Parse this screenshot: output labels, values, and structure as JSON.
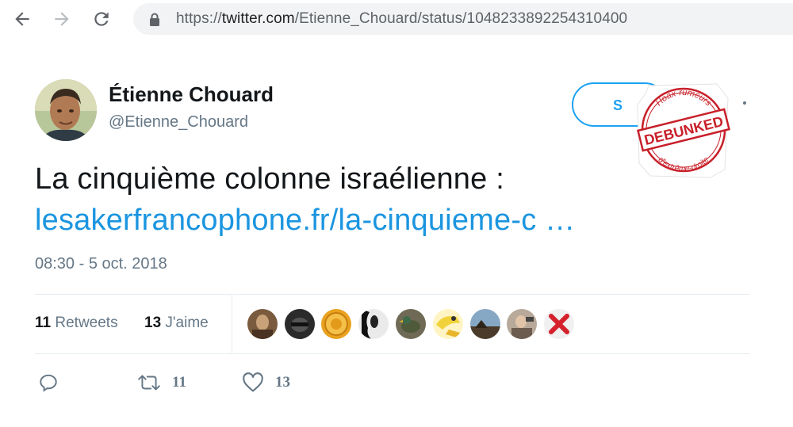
{
  "browser": {
    "url_scheme": "https://",
    "url_host": "twitter.com",
    "url_path": "/Etienne_Chouard/status/1048233892254310400",
    "back_icon": "arrow-left-icon",
    "forward_icon": "arrow-right-icon",
    "reload_icon": "reload-icon",
    "lock_icon": "lock-icon"
  },
  "tweet": {
    "author_name": "Étienne Chouard",
    "author_handle": "@Etienne_Chouard",
    "follow_label_visible": "S",
    "text": "La cinquième colonne israélienne :",
    "link": "lesakerfrancophone.fr/la-cinquieme-c …",
    "timestamp": "08:30 - 5 oct. 2018",
    "stats": {
      "retweets_count": "11",
      "retweets_label": "Retweets",
      "likes_count": "13",
      "likes_label": "J'aime"
    },
    "likers": [
      "liker-avatar-1",
      "liker-avatar-2",
      "liker-avatar-3",
      "liker-avatar-4",
      "liker-avatar-5",
      "liker-avatar-6",
      "liker-avatar-7",
      "liker-avatar-8",
      "liker-avatar-9"
    ],
    "actions": {
      "reply_icon": "reply-icon",
      "retweet_icon": "retweet-icon",
      "retweet_count": "11",
      "like_icon": "heart-icon",
      "like_count": "13"
    }
  },
  "stamp": {
    "top_text": "Hoax-rumeurs",
    "center_text": "DEBUNKED",
    "bottom_text": "d'extrême-droite",
    "color": "#c8202a"
  },
  "colors": {
    "link": "#1b95e0",
    "accent": "#1da1f2",
    "muted": "#657786",
    "text": "#14171a"
  }
}
